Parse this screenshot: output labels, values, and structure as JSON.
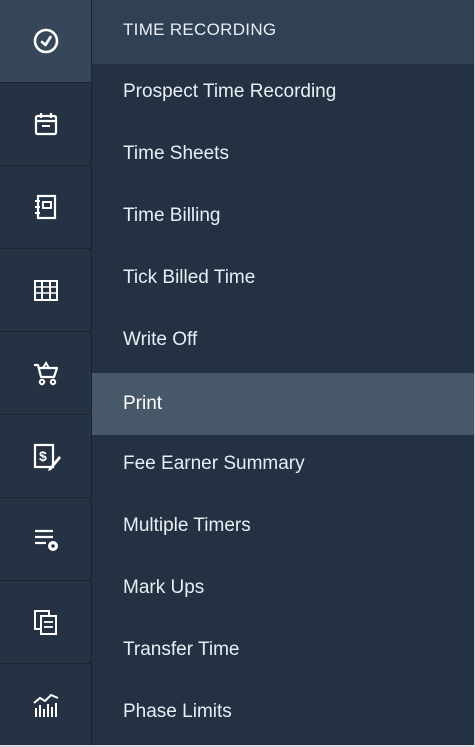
{
  "rail": {
    "icons": [
      {
        "name": "clock-icon",
        "active": true
      },
      {
        "name": "calendar-icon",
        "active": false
      },
      {
        "name": "notebook-icon",
        "active": false
      },
      {
        "name": "ledger-icon",
        "active": false
      },
      {
        "name": "shopping-cart-icon",
        "active": false
      },
      {
        "name": "invoice-pen-icon",
        "active": false
      },
      {
        "name": "list-settings-icon",
        "active": false
      },
      {
        "name": "copy-documents-icon",
        "active": false
      },
      {
        "name": "bar-chart-trend-icon",
        "active": false
      }
    ]
  },
  "menu": {
    "header": "TIME RECORDING",
    "items": [
      {
        "label": "Prospect Time Recording",
        "selected": false
      },
      {
        "label": "Time Sheets",
        "selected": false
      },
      {
        "label": "Time Billing",
        "selected": false
      },
      {
        "label": "Tick Billed Time",
        "selected": false
      },
      {
        "label": "Write Off",
        "selected": false
      },
      {
        "label": "Print",
        "selected": true
      },
      {
        "label": "Fee Earner Summary",
        "selected": false
      },
      {
        "label": "Multiple Timers",
        "selected": false
      },
      {
        "label": "Mark Ups",
        "selected": false
      },
      {
        "label": "Transfer Time",
        "selected": false
      },
      {
        "label": "Phase Limits",
        "selected": false
      }
    ]
  },
  "colors": {
    "rail_bg": "#253243",
    "rail_active": "#37475a",
    "menu_bg": "#233142",
    "header_bg": "#314154",
    "selected_bg": "#475869",
    "text": "#e9eef4"
  }
}
